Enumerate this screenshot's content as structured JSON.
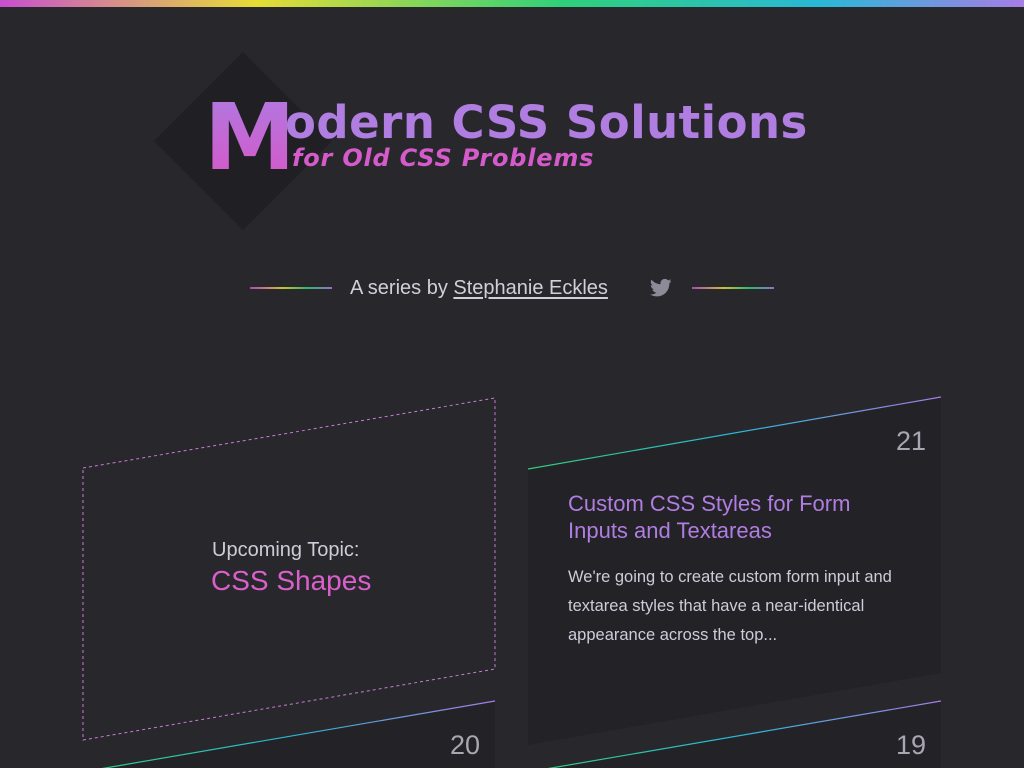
{
  "header": {
    "logo_letter": "M",
    "title_rest": "odern CSS Solutions",
    "subtitle": "for Old CSS Problems"
  },
  "byline": {
    "prefix": "A series by ",
    "author": "Stephanie Eckles",
    "icon": "twitter-icon"
  },
  "upcoming": {
    "label": "Upcoming Topic:",
    "topic": "CSS Shapes"
  },
  "cards": [
    {
      "number": "21",
      "title": "Custom CSS Styles for Form Inputs and Textareas",
      "excerpt": "We're going to create custom form input and textarea styles that have a near-identical appearance across the top..."
    },
    {
      "number": "20"
    },
    {
      "number": "19"
    }
  ],
  "colors": {
    "background": "#28272c",
    "card_background": "#232227",
    "accent_purple": "#b07de0",
    "accent_pink": "#d95fcb"
  }
}
